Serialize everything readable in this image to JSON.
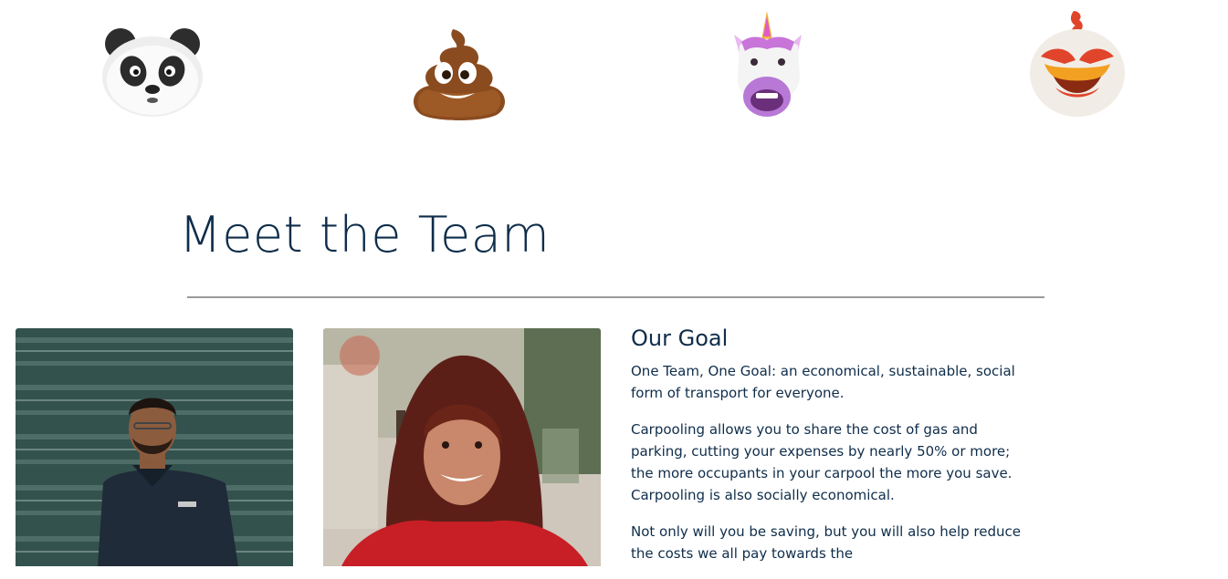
{
  "emojis": [
    {
      "name": "panda-emoji"
    },
    {
      "name": "poop-emoji"
    },
    {
      "name": "unicorn-emoji"
    },
    {
      "name": "chicken-emoji"
    }
  ],
  "team": {
    "title": "Meet the Team",
    "members": [
      {
        "photo": "man-in-dark-polo-photo"
      },
      {
        "photo": "smiling-woman-red-jacket-photo"
      }
    ]
  },
  "goal": {
    "heading": "Our Goal",
    "paragraphs": [
      "One Team, One Goal: an economical, sustainable, social form of transport for everyone.",
      "Carpooling allows you to share the cost of gas and parking, cutting your expenses by nearly 50% or more; the more occupants in your carpool the more you save. Carpooling is also socially economical.",
      "Not only will you be saving, but you will also help reduce the costs we all pay towards the"
    ]
  },
  "colors": {
    "heading": "#0f2d4a",
    "divider": "#9a9a9a",
    "background": "#ffffff"
  }
}
